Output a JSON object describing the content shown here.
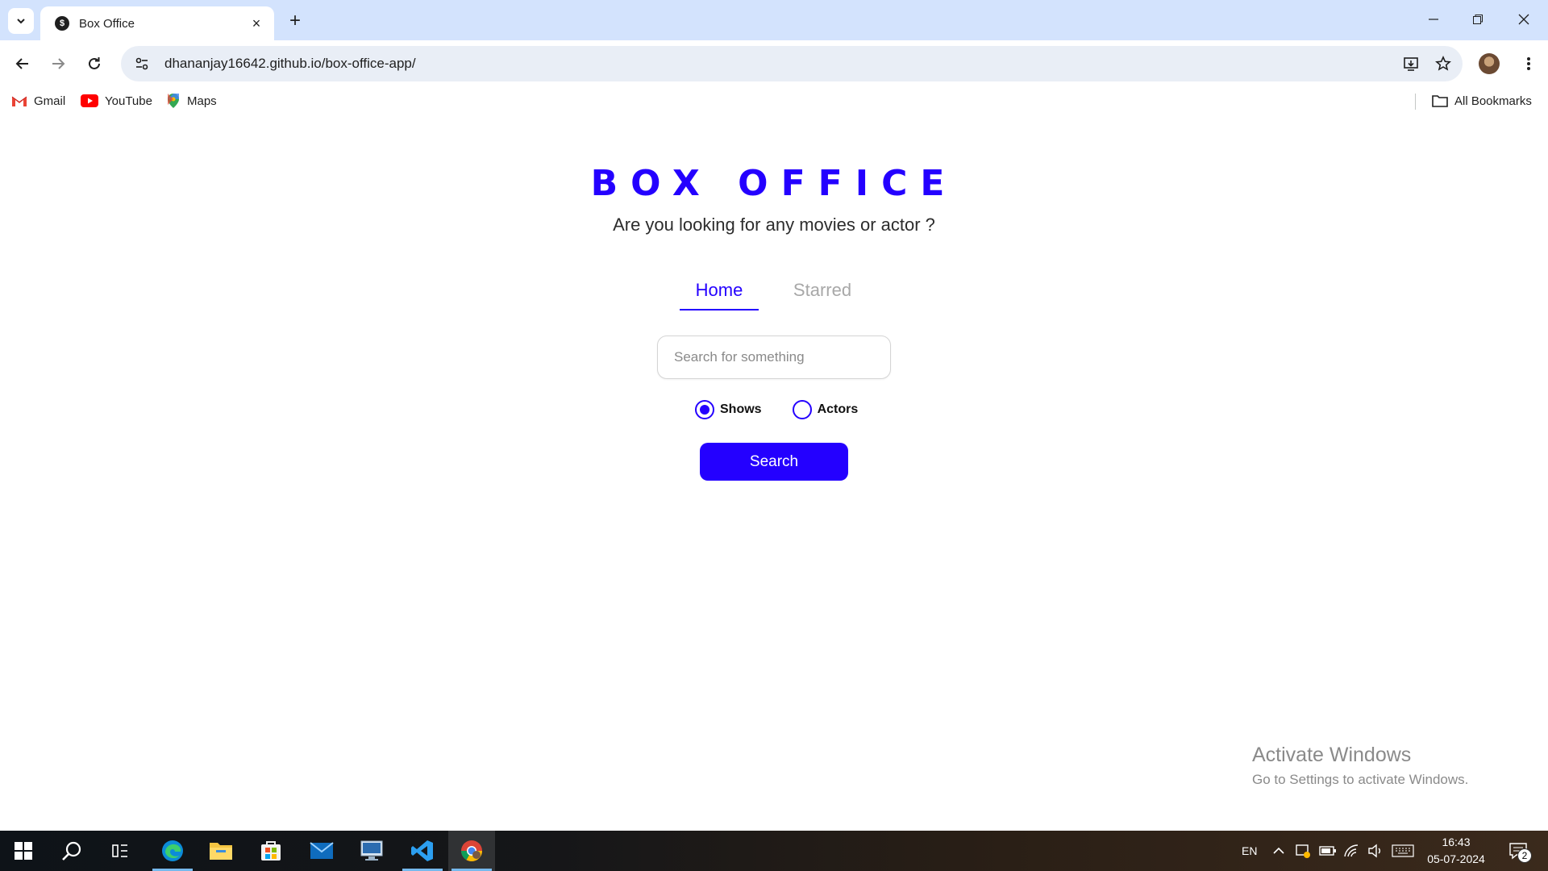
{
  "browser": {
    "tab_title": "Box Office",
    "url": "dhananjay16642.github.io/box-office-app/",
    "bookmarks": [
      {
        "label": "Gmail",
        "icon": "gmail-icon"
      },
      {
        "label": "YouTube",
        "icon": "youtube-icon"
      },
      {
        "label": "Maps",
        "icon": "maps-icon"
      }
    ],
    "all_bookmarks_label": "All Bookmarks"
  },
  "app": {
    "title": "BOX OFFICE",
    "subtitle": "Are you looking for any movies or actor ?",
    "nav": {
      "home": "Home",
      "starred": "Starred",
      "active": "Home"
    },
    "search": {
      "placeholder": "Search for something",
      "value": ""
    },
    "radio": {
      "shows": "Shows",
      "actors": "Actors",
      "selected": "Shows"
    },
    "search_button": "Search",
    "accent_color": "#2400ff"
  },
  "watermark": {
    "title": "Activate Windows",
    "subtitle": "Go to Settings to activate Windows."
  },
  "taskbar": {
    "language": "EN",
    "time": "16:43",
    "date": "05-07-2024",
    "notification_count": "2",
    "apps": [
      "start-icon",
      "search-icon",
      "task-view-icon",
      "edge-icon",
      "file-explorer-icon",
      "store-icon",
      "mail-icon",
      "remote-desktop-icon",
      "vscode-icon",
      "chrome-icon"
    ]
  }
}
